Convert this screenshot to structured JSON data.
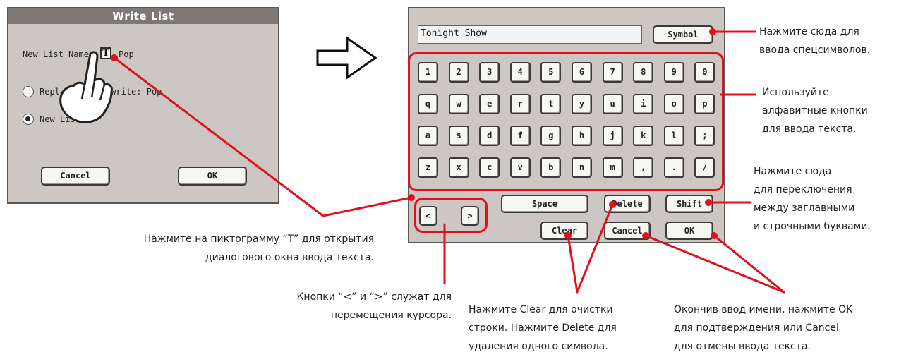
{
  "write_list": {
    "title": "Write List",
    "new_list_name_label": "New List Name",
    "t_icon": "T",
    "name_value": "Pop",
    "option_replace": "Replace / Overwrite: Pop",
    "option_new_list": "New List",
    "cancel_label": "Cancel",
    "ok_label": "OK"
  },
  "text_dialog": {
    "field_value": "Tonight Show",
    "symbol_label": "Symbol",
    "keys_row1": [
      "1",
      "2",
      "3",
      "4",
      "5",
      "6",
      "7",
      "8",
      "9",
      "0"
    ],
    "keys_row2": [
      "q",
      "w",
      "e",
      "r",
      "t",
      "y",
      "u",
      "i",
      "o",
      "p"
    ],
    "keys_row3": [
      "a",
      "s",
      "d",
      "f",
      "g",
      "h",
      "j",
      "k",
      "l",
      ";"
    ],
    "keys_row4": [
      "z",
      "x",
      "c",
      "v",
      "b",
      "n",
      "m",
      ",",
      ".",
      "/"
    ],
    "left_label": "<",
    "right_label": ">",
    "space_label": "Space",
    "delete_label": "Delete",
    "shift_label": "Shift",
    "clear_label": "Clear",
    "cancel_label": "Cancel",
    "ok_label": "OK"
  },
  "captions": {
    "symbol_1": "Нажмите сюда для",
    "symbol_2": "ввода спецсимволов.",
    "alpha_1": "Используйте",
    "alpha_2": "алфавитные кнопки",
    "alpha_3": "для ввода текста.",
    "shift_1": "Нажмите сюда",
    "shift_2": "для переключения",
    "shift_3": "между заглавными",
    "shift_4": "и строчными буквами.",
    "t_1": "Нажмите на пиктограмму “T” для открытия",
    "t_2": "диалогового окна ввода текста.",
    "cursor_1": "Кнопки “<” и “>” служат для",
    "cursor_2": "перемещения курсора.",
    "clear_1": "Нажмите Clear для очистки",
    "clear_2": "строки. Нажмите Delete для",
    "clear_3": "удаления одного символа.",
    "ok_1": "Окончив ввод имени, нажмите OK",
    "ok_2": "для подтверждения или Cancel",
    "ok_3": "для отмены ввода текста."
  },
  "colors": {
    "annotation_red": "#e0101c",
    "panel_gray": "#cdc7c3",
    "title_gray": "#7d7876"
  },
  "icons": [
    "hand-pointer-icon",
    "right-arrow-icon"
  ]
}
